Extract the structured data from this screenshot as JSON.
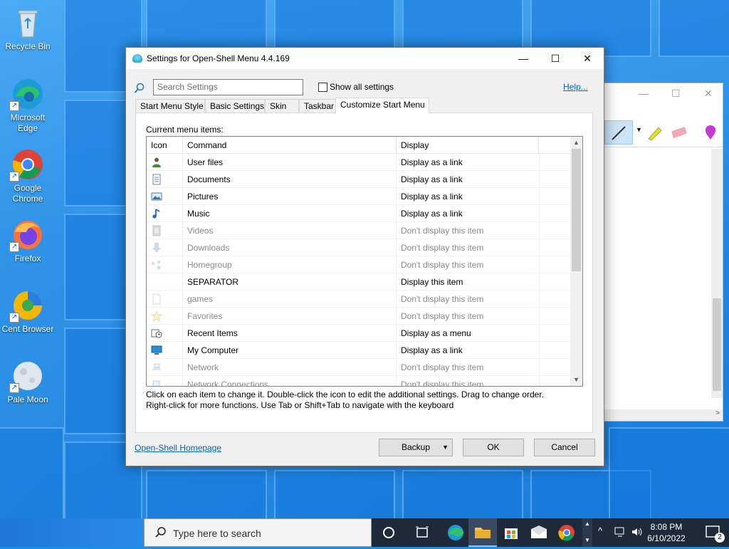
{
  "desktop": {
    "icons": [
      {
        "label": "Recycle Bin"
      },
      {
        "label": "Microsoft Edge"
      },
      {
        "label": "Google Chrome"
      },
      {
        "label": "Firefox"
      },
      {
        "label": "Cent Browser"
      },
      {
        "label": "Pale Moon"
      }
    ]
  },
  "dialog": {
    "title": "Settings for Open-Shell Menu 4.4.169",
    "search_placeholder": "Search Settings",
    "show_all_label": "Show all settings",
    "show_all_checked": false,
    "help_label": "Help...",
    "tabs": [
      {
        "label": "Start Menu Style",
        "active": false
      },
      {
        "label": "Basic Settings",
        "active": false
      },
      {
        "label": "Skin",
        "active": false
      },
      {
        "label": "Taskbar",
        "active": false
      },
      {
        "label": "Customize Start Menu",
        "active": true
      }
    ],
    "list_caption": "Current menu items:",
    "columns": [
      "Icon",
      "Command",
      "Display"
    ],
    "rows": [
      {
        "command": "User files",
        "display": "Display as a link",
        "enabled": true,
        "icon": "user-icon"
      },
      {
        "command": "Documents",
        "display": "Display as a link",
        "enabled": true,
        "icon": "document-icon"
      },
      {
        "command": "Pictures",
        "display": "Display as a link",
        "enabled": true,
        "icon": "picture-icon"
      },
      {
        "command": "Music",
        "display": "Display as a link",
        "enabled": true,
        "icon": "music-icon"
      },
      {
        "command": "Videos",
        "display": "Don't display this item",
        "enabled": false,
        "icon": "video-icon"
      },
      {
        "command": "Downloads",
        "display": "Don't display this item",
        "enabled": false,
        "icon": "download-icon"
      },
      {
        "command": "Homegroup",
        "display": "Don't display this item",
        "enabled": false,
        "icon": "homegroup-icon"
      },
      {
        "command": "SEPARATOR",
        "display": "Display this item",
        "enabled": true,
        "icon": ""
      },
      {
        "command": "games",
        "display": "Don't display this item",
        "enabled": false,
        "icon": "blank-page-icon"
      },
      {
        "command": "Favorites",
        "display": "Don't display this item",
        "enabled": false,
        "icon": "star-icon"
      },
      {
        "command": "Recent Items",
        "display": "Display as a menu",
        "enabled": true,
        "icon": "recent-items-icon"
      },
      {
        "command": "My Computer",
        "display": "Display as a link",
        "enabled": true,
        "icon": "computer-icon"
      },
      {
        "command": "Network",
        "display": "Don't display this item",
        "enabled": false,
        "icon": "network-icon"
      },
      {
        "command": "Network Connections",
        "display": "Don't display this item",
        "enabled": false,
        "icon": "network-connections-icon"
      }
    ],
    "hint_line1": "Click on each item to change it. Double-click the icon to edit the additional settings. Drag to change order.",
    "hint_line2": "Right-click for more functions. Use Tab or Shift+Tab to navigate with the keyboard",
    "homepage_label": "Open-Shell Homepage",
    "backup_label": "Backup",
    "ok_label": "OK",
    "cancel_label": "Cancel"
  },
  "taskbar": {
    "search_placeholder": "Type here to search",
    "time": "8:08 PM",
    "date": "6/10/2022",
    "notification_count": "2"
  }
}
